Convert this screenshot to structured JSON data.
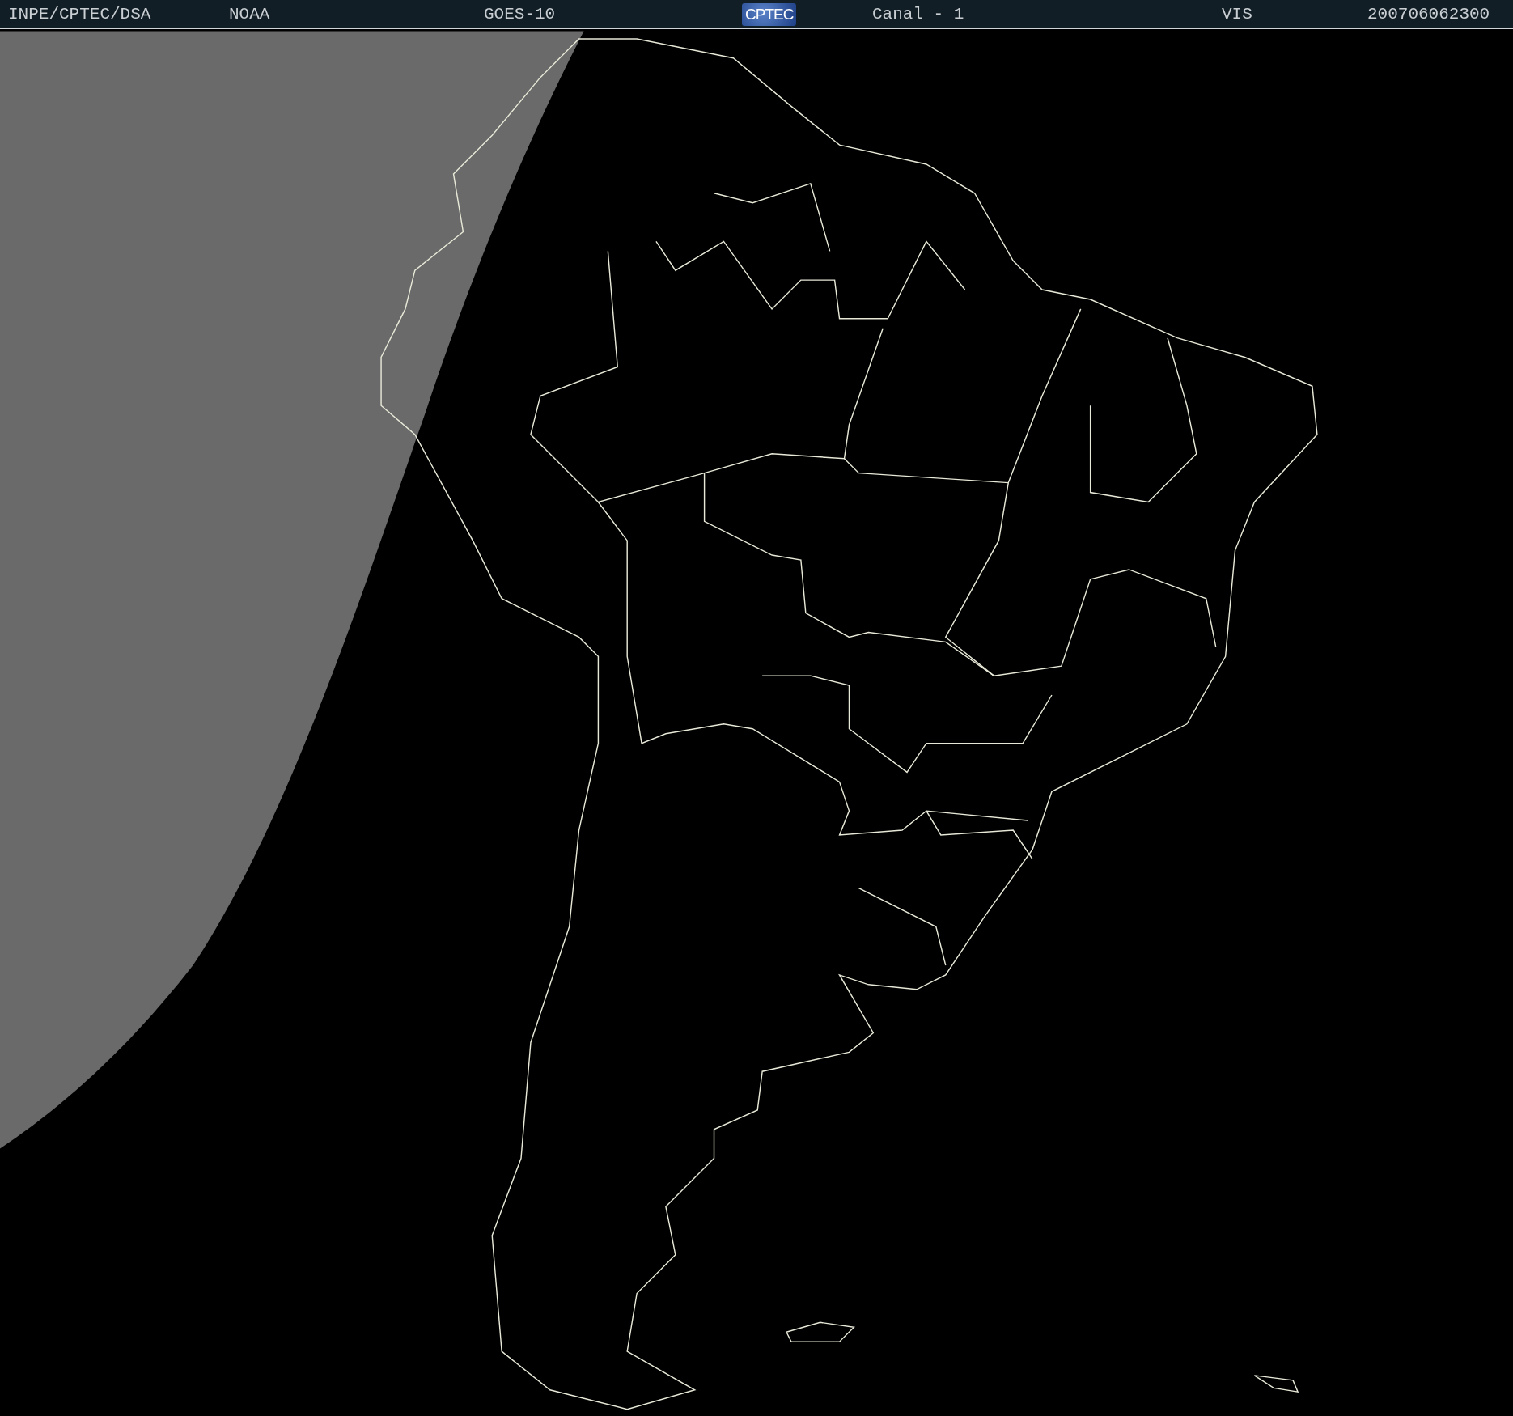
{
  "header": {
    "items": [
      {
        "kind": "text",
        "text": "INPE/CPTEC/DSA"
      },
      {
        "kind": "text",
        "text": "NOAA"
      },
      {
        "kind": "text",
        "text": "GOES-10"
      },
      {
        "kind": "logo",
        "text": "CPTEC"
      },
      {
        "kind": "text",
        "text": "Canal - 1"
      },
      {
        "kind": "text",
        "text": "VIS"
      },
      {
        "kind": "text",
        "text": "200706062300"
      }
    ]
  }
}
